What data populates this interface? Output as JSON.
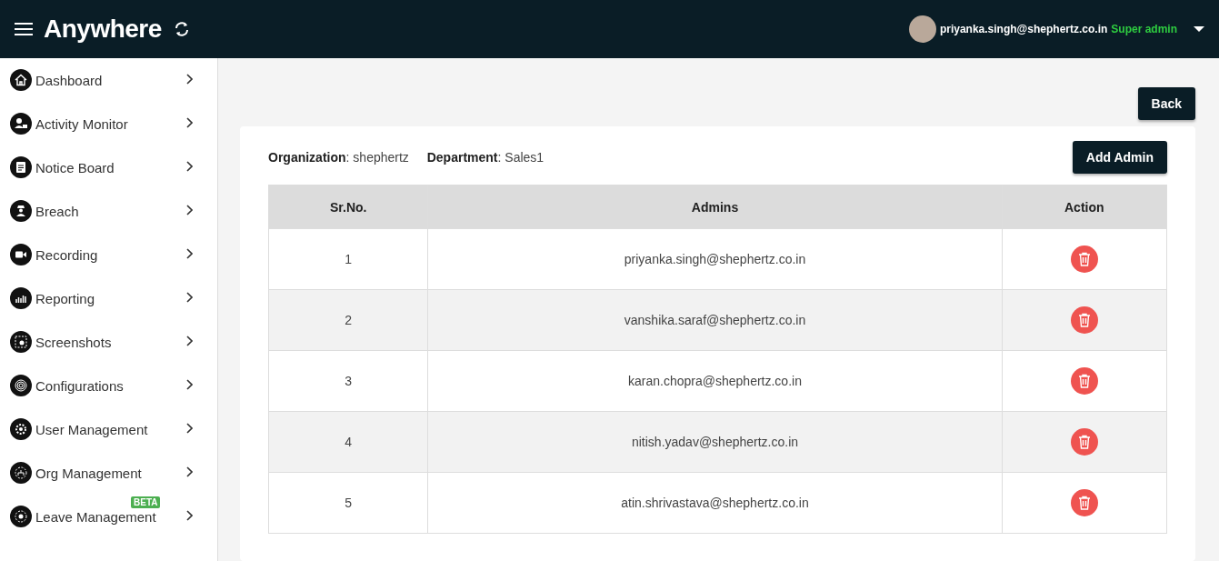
{
  "header": {
    "logo": "Anywhere",
    "user_email": "priyanka.singh@shephertz.co.in",
    "user_role": "Super admin"
  },
  "sidebar": {
    "items": [
      {
        "label": "Dashboard"
      },
      {
        "label": "Activity Monitor"
      },
      {
        "label": "Notice Board"
      },
      {
        "label": "Breach"
      },
      {
        "label": "Recording"
      },
      {
        "label": "Reporting"
      },
      {
        "label": "Screenshots"
      },
      {
        "label": "Configurations"
      },
      {
        "label": "User Management"
      },
      {
        "label": "Org Management"
      },
      {
        "label": "Leave Management",
        "badge": "BETA"
      }
    ]
  },
  "back_button": "Back",
  "info": {
    "organization": "**Organization**: shephertz",
    "department": "**Department**: Sales1"
  },
  "add_admin_button": "Add Admin",
  "table": {
    "columns": [
      "Sr.No.",
      "Admins",
      "Action"
    ],
    "rows": [
      {
        "sr": "1",
        "admin": "priyanka.singh@shephertz.co.in"
      },
      {
        "sr": "2",
        "admin": "vanshika.saraf@shephertz.co.in"
      },
      {
        "sr": "3",
        "admin": "karan.chopra@shephertz.co.in"
      },
      {
        "sr": "4",
        "admin": "nitish.yadav@shephertz.co.in"
      },
      {
        "sr": "5",
        "admin": "atin.shrivastava@shephertz.co.in"
      }
    ]
  }
}
